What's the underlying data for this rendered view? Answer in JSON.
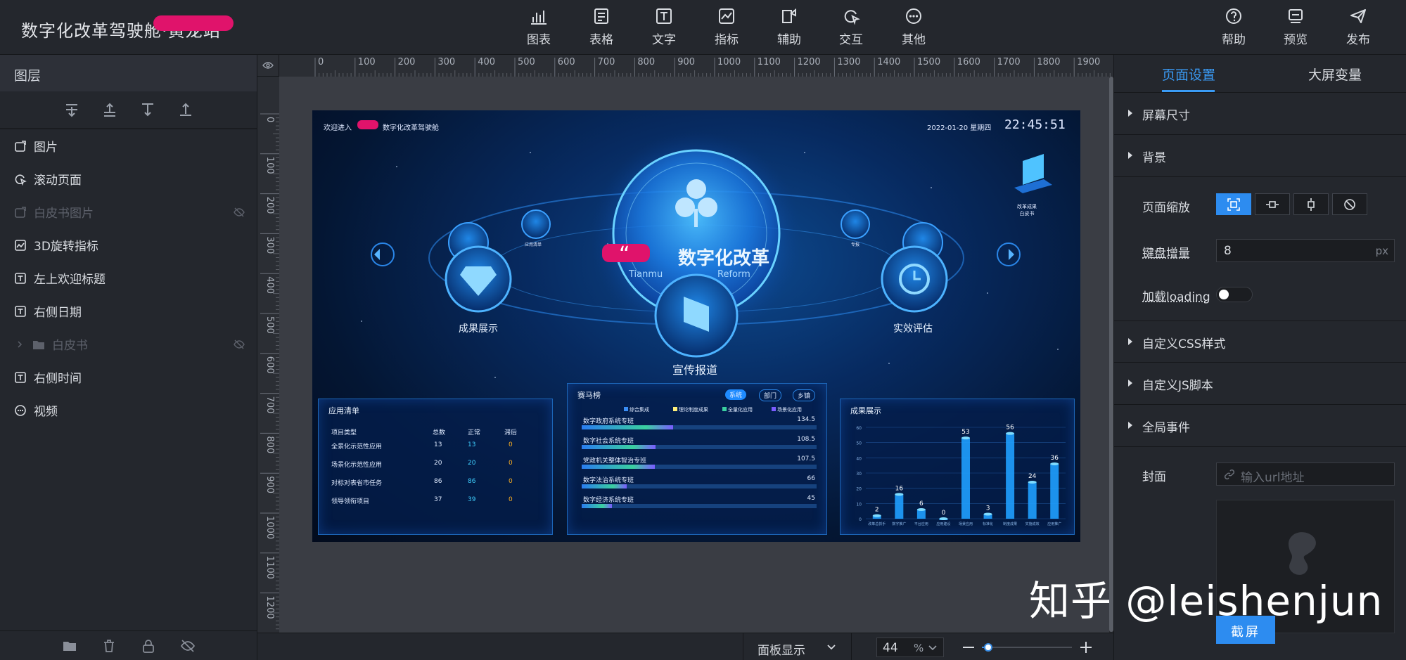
{
  "app": {
    "title": "数字化改革驾驶舱·黄龙站"
  },
  "toolbar": {
    "center": [
      {
        "label": "图表",
        "icon": "bar-chart-icon"
      },
      {
        "label": "表格",
        "icon": "table-icon"
      },
      {
        "label": "文字",
        "icon": "text-icon"
      },
      {
        "label": "指标",
        "icon": "indicator-icon"
      },
      {
        "label": "辅助",
        "icon": "auxiliary-icon"
      },
      {
        "label": "交互",
        "icon": "interaction-icon"
      },
      {
        "label": "其他",
        "icon": "more-icon"
      }
    ],
    "right": [
      {
        "label": "帮助",
        "icon": "help-icon"
      },
      {
        "label": "预览",
        "icon": "preview-icon"
      },
      {
        "label": "发布",
        "icon": "publish-icon"
      }
    ]
  },
  "layers": {
    "header": "图层",
    "items": [
      {
        "label": "图片",
        "icon": "image-icon",
        "hidden": false
      },
      {
        "label": "滚动页面",
        "icon": "scroll-page-icon",
        "hidden": false
      },
      {
        "label": "白皮书图片",
        "icon": "image-icon",
        "hidden": true
      },
      {
        "label": "3D旋转指标",
        "icon": "indicator-icon",
        "hidden": false
      },
      {
        "label": "左上欢迎标题",
        "icon": "text-icon",
        "hidden": false
      },
      {
        "label": "右侧日期",
        "icon": "text-icon",
        "hidden": false
      },
      {
        "label": "白皮书",
        "icon": "folder-icon",
        "hidden": true
      },
      {
        "label": "右侧时间",
        "icon": "text-icon",
        "hidden": false
      },
      {
        "label": "视频",
        "icon": "more-icon",
        "hidden": false
      }
    ]
  },
  "ruler": {
    "h_ticks": [
      "0",
      "100",
      "200",
      "300",
      "400",
      "500",
      "600",
      "700",
      "800",
      "900",
      "1000",
      "1100",
      "1200",
      "1300",
      "1400",
      "1500",
      "1600",
      "1700",
      "1800",
      "1900"
    ],
    "v_ticks": [
      "0",
      "100",
      "200",
      "300",
      "400",
      "500",
      "600",
      "700",
      "800",
      "900",
      "1000",
      "1100",
      "1200"
    ]
  },
  "bottombar": {
    "panel_display": "面板显示",
    "zoom_value": "44",
    "zoom_unit": "%",
    "zoom_fraction": 0.07
  },
  "right_panel": {
    "tabs": [
      "页面设置",
      "大屏变量"
    ],
    "sections": {
      "screen_size": "屏幕尺寸",
      "background": "背景",
      "page_scale": "页面缩放",
      "keyboard_step": "键盘增量",
      "keyboard_step_value": "8",
      "keyboard_step_unit": "px",
      "loading": "加载loading",
      "custom_css": "自定义CSS样式",
      "custom_js": "自定义JS脚本",
      "global_events": "全局事件",
      "cover": "封面",
      "cover_placeholder": "输入url地址",
      "screenshot_button": "截屏"
    }
  },
  "screen": {
    "welcome": "欢迎进入",
    "welcome_suffix": "数字化改革驾驶舱",
    "date": "2022-01-20 星期四",
    "time": "22:45:51",
    "hero_title": "数字化改革",
    "hero_quote": "“",
    "hero_subtitle_left": "Tianmu",
    "hero_subtitle_right": "Reform",
    "nodes": [
      "成果展示",
      "宣传报道",
      "实效评估"
    ],
    "small_nodes": [
      "应用清单",
      "专报"
    ],
    "whitebook": "改革成果\n白皮书",
    "app_list": {
      "title": "应用清单",
      "headers": [
        "项目类型",
        "总数",
        "正常",
        "滞后"
      ],
      "rows": [
        [
          "全景化示范性应用",
          "13",
          "13",
          "0"
        ],
        [
          "场景化示范性应用",
          "20",
          "20",
          "0"
        ],
        [
          "对标对表省市任务",
          "86",
          "86",
          "0"
        ],
        [
          "领导领衔项目",
          "37",
          "39",
          "0"
        ]
      ]
    },
    "ranking": {
      "title": "赛马榜",
      "tabs": [
        "系统",
        "部门",
        "乡镇"
      ],
      "legend": [
        "综合集成",
        "理论制度成果",
        "全量化应用",
        "场景化应用"
      ],
      "rows": [
        {
          "label": "数字政府系统专班",
          "value": "134.5"
        },
        {
          "label": "数字社会系统专班",
          "value": "108.5"
        },
        {
          "label": "党政机关整体智治专班",
          "value": "107.5"
        },
        {
          "label": "数字法治系统专班",
          "value": "66"
        },
        {
          "label": "数字经济系统专班",
          "value": "45"
        }
      ]
    },
    "results": {
      "title": "成果展示",
      "y_ticks": [
        "60",
        "50",
        "40",
        "30",
        "20",
        "10",
        "0"
      ],
      "categories": [
        "改革总抓手",
        "数字推广",
        "平台应用",
        "应用建设",
        "场景应用",
        "标准化",
        "制度成果",
        "实施成效",
        "应用推广"
      ]
    }
  },
  "chart_data": {
    "type": "bar",
    "title": "成果展示",
    "categories": [
      "改革总抓手",
      "数字推广",
      "平台应用",
      "应用建设",
      "场景应用",
      "标准化",
      "制度成果",
      "实施成效",
      "应用推广"
    ],
    "values": [
      2,
      16,
      6,
      0,
      53,
      3,
      56,
      24,
      36
    ],
    "ylim": [
      0,
      60
    ]
  },
  "watermark": "知乎 @leishenjun",
  "colors": {
    "accent": "#2d8cf0",
    "tab_active": "#3a9bf5",
    "blot": "#e0136b"
  }
}
